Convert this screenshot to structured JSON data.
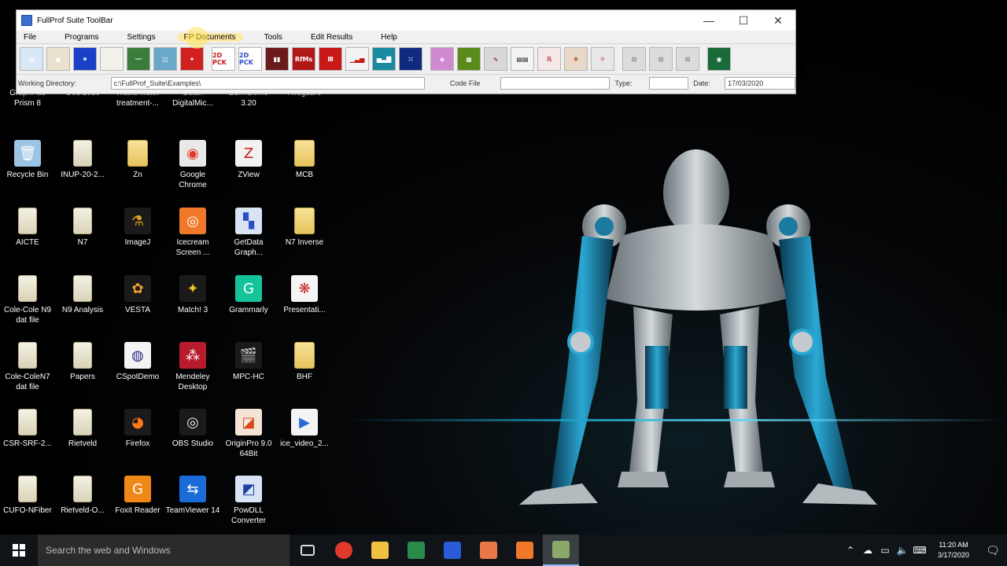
{
  "window": {
    "title": "FullProf Suite ToolBar",
    "menu": [
      "File",
      "Programs",
      "Settings",
      "FP Documents",
      "Tools",
      "Edit Results",
      "Help"
    ],
    "toolbar_buttons": [
      {
        "name": "editor-button",
        "glyph": "▤",
        "color": "#d9e8f6"
      },
      {
        "name": "notes-button",
        "glyph": "▣",
        "color": "#e8e2cf"
      },
      {
        "name": "star-button",
        "glyph": "✷",
        "color": "#1a40c8"
      },
      {
        "name": "checklist-button",
        "glyph": "✓",
        "color": "#f2f2ea"
      },
      {
        "name": "plot-button",
        "glyph": "〰",
        "color": "#3a7d3a"
      },
      {
        "name": "pattern-button",
        "glyph": "◫",
        "color": "#6aa8c8"
      },
      {
        "name": "crystal-button",
        "glyph": "✦",
        "color": "#d21f1f"
      },
      {
        "name": "pck2d-button",
        "glyph": "2D PCK",
        "color": "#ffffff",
        "fg": "#c81818"
      },
      {
        "name": "pck2d-alt-button",
        "glyph": "2D PCK",
        "color": "#ffffff",
        "fg": "#2a4ec8"
      },
      {
        "name": "bars-button",
        "glyph": "▮▮",
        "color": "#6a1a1a"
      },
      {
        "name": "refine-button",
        "glyph": "RfMs",
        "color": "#b01818"
      },
      {
        "name": "matrix-button",
        "glyph": "Ⅲ",
        "color": "#c81818"
      },
      {
        "name": "histogram-button",
        "glyph": "▁▃▅",
        "color": "#f4f4f4",
        "fg": "#c81818"
      },
      {
        "name": "spectrum-button",
        "glyph": "▅▃▇",
        "color": "#1a8aa0"
      },
      {
        "name": "lattice-button",
        "glyph": "⁙",
        "color": "#102a80"
      },
      {
        "name": "texture-button",
        "glyph": "◈",
        "color": "#d08ad0"
      },
      {
        "name": "map-button",
        "glyph": "▦",
        "color": "#5a8a1a"
      },
      {
        "name": "fit-button",
        "glyph": "∿",
        "color": "#d8d8d8",
        "fg": "#a01818"
      },
      {
        "name": "data-button",
        "glyph": "▤▤",
        "color": "#f4f4f4",
        "fg": "#222"
      },
      {
        "name": "result-button",
        "glyph": "ℝ",
        "color": "#f4e8e8",
        "fg": "#a01818"
      },
      {
        "name": "structure-button",
        "glyph": "❖",
        "color": "#e8d8c8",
        "fg": "#c85018"
      },
      {
        "name": "molecule-button",
        "glyph": "⚛",
        "color": "#e8e8e8",
        "fg": "#c81818"
      },
      {
        "name": "disabled-1-button",
        "glyph": "⊠",
        "color": "#dcdcdc",
        "fg": "#888"
      },
      {
        "name": "disabled-2-button",
        "glyph": "⊠",
        "color": "#dcdcdc",
        "fg": "#888"
      },
      {
        "name": "disabled-3-button",
        "glyph": "⊠",
        "color": "#dcdcdc",
        "fg": "#888"
      },
      {
        "name": "globe-button",
        "glyph": "◉",
        "color": "#1a6a3a"
      }
    ],
    "status": {
      "working_dir_label": "Working Directory:",
      "working_dir_value": "c:\\FullProf_Suite\\Examples\\",
      "code_file_label": "Code File",
      "code_file_value": "",
      "type_label": "Type:",
      "type_value": "",
      "date_label": "Date:",
      "date_value": "17/03/2020"
    }
  },
  "desktop_icons": [
    {
      "label": "GraphPad Prism 8",
      "kind": "app",
      "color": "#c8d8f0",
      "glyph": "◧"
    },
    {
      "label": "Goa 2020",
      "kind": "app",
      "color": "#444",
      "glyph": ""
    },
    {
      "label": "Waste water treatment-...",
      "kind": "app",
      "color": "#444",
      "glyph": ""
    },
    {
      "label": "Gatan DigitalMic...",
      "kind": "app",
      "color": "#444",
      "glyph": ""
    },
    {
      "label": "ZSimDemo 3.20",
      "kind": "app",
      "color": "#444",
      "glyph": ""
    },
    {
      "label": "Avogadro",
      "kind": "app",
      "color": "#444",
      "glyph": ""
    },
    {
      "label": "Recycle Bin",
      "kind": "app",
      "color": "#9cc4e4",
      "glyph": "🗑"
    },
    {
      "label": "INUP-20-2...",
      "kind": "doc"
    },
    {
      "label": "Zn",
      "kind": "folder"
    },
    {
      "label": "Google Chrome",
      "kind": "app",
      "color": "#e8e8e8",
      "glyph": "◉",
      "fg": "#e23a2a"
    },
    {
      "label": "ZView",
      "kind": "app",
      "color": "#f2f2f2",
      "glyph": "Z",
      "fg": "#c81818"
    },
    {
      "label": "MCB",
      "kind": "folder"
    },
    {
      "label": "AICTE",
      "kind": "doc"
    },
    {
      "label": "N7",
      "kind": "doc"
    },
    {
      "label": "ImageJ",
      "kind": "app",
      "color": "#1a1a1a",
      "glyph": "⚗",
      "fg": "#d8a020"
    },
    {
      "label": "Icecream Screen ...",
      "kind": "app",
      "color": "#f07828",
      "glyph": "◎"
    },
    {
      "label": "GetData Graph...",
      "kind": "app",
      "color": "#d8e4f4",
      "glyph": "▚",
      "fg": "#2a4ec8"
    },
    {
      "label": "N7 Inverse",
      "kind": "folder"
    },
    {
      "label": "Cole-Cole N9 dat file",
      "kind": "doc"
    },
    {
      "label": "N9 Analysis",
      "kind": "doc"
    },
    {
      "label": "VESTA",
      "kind": "app",
      "color": "#1a1a1a",
      "glyph": "✿",
      "fg": "#f0a030"
    },
    {
      "label": "Match! 3",
      "kind": "app",
      "color": "#1a1a1a",
      "glyph": "✦",
      "fg": "#f0c020"
    },
    {
      "label": "Grammarly",
      "kind": "app",
      "color": "#15c39a",
      "glyph": "G"
    },
    {
      "label": "Presentati...",
      "kind": "app",
      "color": "#f4f4f4",
      "glyph": "❋",
      "fg": "#c82828"
    },
    {
      "label": "Cole-ColeN7 dat file",
      "kind": "doc"
    },
    {
      "label": "Papers",
      "kind": "doc"
    },
    {
      "label": "CSpotDemo",
      "kind": "app",
      "color": "#f4f4f4",
      "glyph": "◍",
      "fg": "#2a2a8a"
    },
    {
      "label": "Mendeley Desktop",
      "kind": "app",
      "color": "#b81c2c",
      "glyph": "⁂"
    },
    {
      "label": "MPC-HC",
      "kind": "app",
      "color": "#1a1a1a",
      "glyph": "🎬",
      "fg": "#fff"
    },
    {
      "label": "BHF",
      "kind": "folder"
    },
    {
      "label": "CSR-SRF-2...",
      "kind": "doc"
    },
    {
      "label": "Rietveld",
      "kind": "doc"
    },
    {
      "label": "Firefox",
      "kind": "app",
      "color": "#1a1a1a",
      "glyph": "◕",
      "fg": "#ff7a18"
    },
    {
      "label": "OBS Studio",
      "kind": "app",
      "color": "#1a1a1a",
      "glyph": "◎",
      "fg": "#e8e8e8"
    },
    {
      "label": "OriginPro 9.0 64Bit",
      "kind": "app",
      "color": "#f4e4d8",
      "glyph": "◪",
      "fg": "#d84818"
    },
    {
      "label": "ice_video_2...",
      "kind": "app",
      "color": "#f4f4f4",
      "glyph": "▶",
      "fg": "#2a6ad8"
    },
    {
      "label": "CUFO-NFiber",
      "kind": "doc"
    },
    {
      "label": "Rietveld-O...",
      "kind": "doc"
    },
    {
      "label": "Foxit Reader",
      "kind": "app",
      "color": "#f08818",
      "glyph": "G"
    },
    {
      "label": "TeamViewer 14",
      "kind": "app",
      "color": "#1a6ad8",
      "glyph": "⇆"
    },
    {
      "label": "PowDLL Converter",
      "kind": "app",
      "color": "#d8e4f4",
      "glyph": "◩",
      "fg": "#1a40a0"
    }
  ],
  "taskbar": {
    "search_placeholder": "Search the web and Windows",
    "apps": [
      {
        "name": "task-view",
        "color": "#555"
      },
      {
        "name": "chrome",
        "color": "#e23a2a"
      },
      {
        "name": "file-explorer",
        "color": "#f0c040"
      },
      {
        "name": "excel",
        "color": "#2a8a4a"
      },
      {
        "name": "word",
        "color": "#2a5ad8"
      },
      {
        "name": "origin",
        "color": "#e87848"
      },
      {
        "name": "icecream",
        "color": "#f07828"
      },
      {
        "name": "fullprof",
        "color": "#8aa868",
        "active": true
      }
    ],
    "clock_time": "11:20 AM",
    "clock_date": "3/17/2020"
  }
}
